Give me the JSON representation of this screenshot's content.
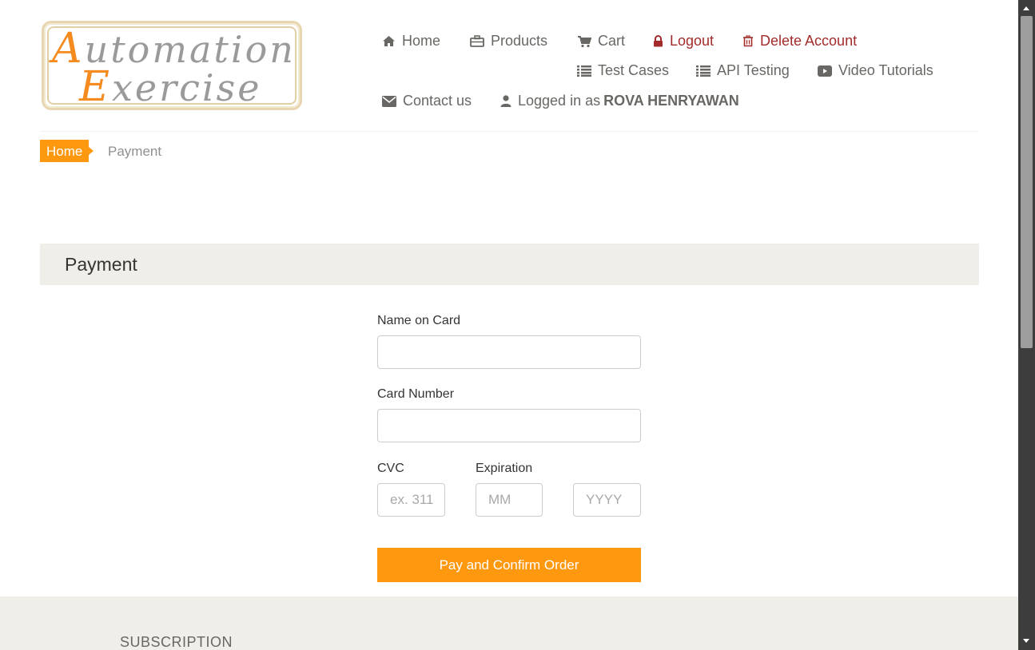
{
  "logo": {
    "line1_cap": "A",
    "line1_rest": "utomation",
    "line2_cap": "E",
    "line2_rest": "xercise"
  },
  "nav": {
    "home": "Home",
    "products": "Products",
    "cart": "Cart",
    "logout": "Logout",
    "delete_account": "Delete Account",
    "test_cases": "Test Cases",
    "api_testing": "API Testing",
    "video_tutorials": "Video Tutorials",
    "contact_us": "Contact us",
    "logged_in_prefix": "Logged in as",
    "logged_in_user": "ROVA HENRYAWAN"
  },
  "breadcrumb": {
    "home": "Home",
    "current": "Payment"
  },
  "payment": {
    "heading": "Payment",
    "name_label": "Name on Card",
    "name_value": "",
    "card_label": "Card Number",
    "card_value": "",
    "cvc_label": "CVC",
    "cvc_placeholder": "ex. 311",
    "expiration_label": "Expiration",
    "month_placeholder": "MM",
    "year_placeholder": "YYYY",
    "submit_label": "Pay and Confirm Order"
  },
  "footer": {
    "subscription": "SUBSCRIPTION"
  },
  "colors": {
    "accent": "#fe980f",
    "danger": "#a32b2b",
    "text": "#696763",
    "panel": "#efeee8"
  },
  "icons": [
    "home-icon",
    "briefcase-icon",
    "cart-icon",
    "lock-icon",
    "trash-icon",
    "list-icon",
    "youtube-icon",
    "envelope-icon",
    "user-icon"
  ]
}
